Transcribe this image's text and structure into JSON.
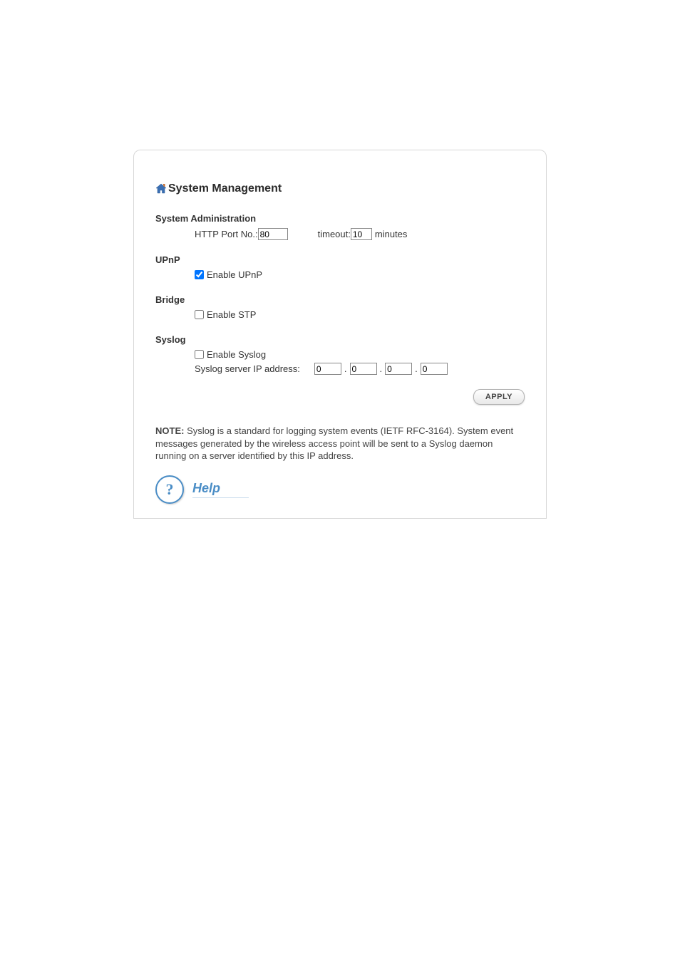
{
  "page": {
    "title": "System Management"
  },
  "sysadmin": {
    "heading": "System Administration",
    "http_port_label": "HTTP Port No.:",
    "http_port_value": "80",
    "timeout_label": "timeout:",
    "timeout_value": "10",
    "timeout_unit": "minutes"
  },
  "upnp": {
    "heading": "UPnP",
    "enable_label": "Enable UPnP",
    "enabled": true
  },
  "bridge": {
    "heading": "Bridge",
    "enable_label": "Enable STP",
    "enabled": false
  },
  "syslog": {
    "heading": "Syslog",
    "enable_label": "Enable Syslog",
    "enabled": false,
    "server_label": "Syslog server IP address:",
    "ip": {
      "a": "0",
      "b": "0",
      "c": "0",
      "d": "0"
    }
  },
  "buttons": {
    "apply": "APPLY"
  },
  "note": {
    "prefix": "NOTE:",
    "text": " Syslog is a standard for logging system events (IETF RFC-3164). System event messages generated by the wireless access point will be sent to a Syslog daemon running on a server identified by this IP address."
  },
  "help": {
    "label": "Help"
  }
}
